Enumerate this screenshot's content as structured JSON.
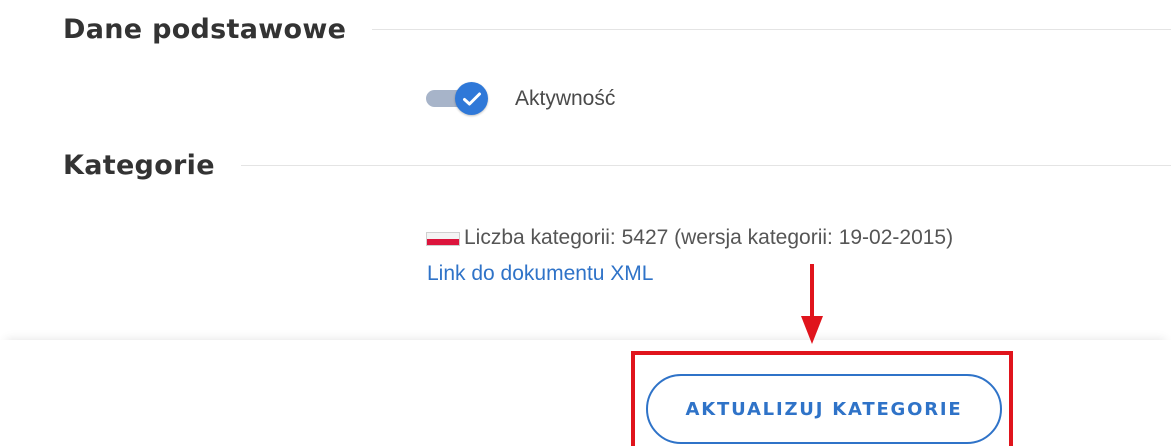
{
  "sections": {
    "basic": {
      "title": "Dane podstawowe"
    },
    "categories": {
      "title": "Kategorie"
    }
  },
  "activity_toggle": {
    "label": "Aktywność",
    "checked": true,
    "track_color": "#a7b4c9",
    "knob_color": "#2f78d8",
    "icon": "check-icon"
  },
  "category_info": {
    "flag_icon": "poland-flag-icon",
    "text": "Liczba kategorii: 5427 (wersja kategorii: 19-02-2015)",
    "xml_link_label": "Link do dokumentu XML"
  },
  "update_button": {
    "label": "AKTUALIZUJ KATEGORIE"
  },
  "annotation": {
    "color": "#e0141c",
    "arrow_icon": "arrow-down-icon"
  },
  "colors": {
    "accent": "#2f73c8",
    "annotation_red": "#e0141c"
  }
}
